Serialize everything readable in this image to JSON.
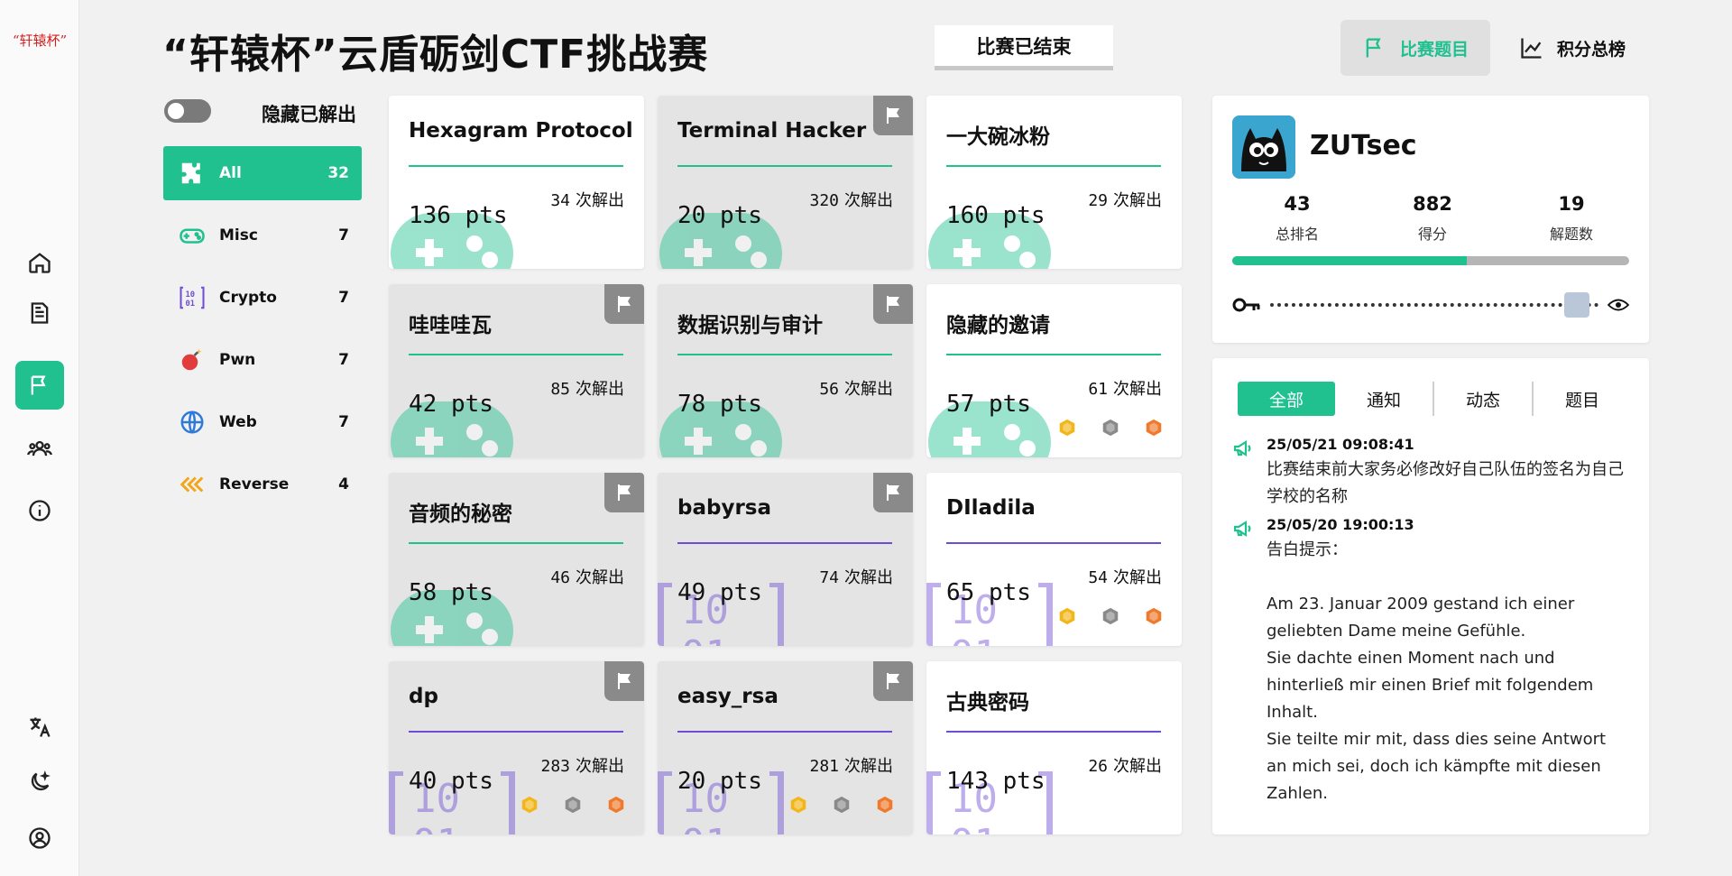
{
  "rail": {
    "logo": "“轩辕杯”",
    "items": [
      "home-icon",
      "document-icon",
      "flag-icon",
      "team-icon",
      "info-icon"
    ],
    "bottom": [
      "translate-icon",
      "theme-icon",
      "user-icon"
    ]
  },
  "header": {
    "title": "“轩辕杯”云盾砺剑CTF挑战赛",
    "status": "比赛已结束",
    "nav": [
      {
        "label": "比赛题目",
        "icon": "flag-icon",
        "active": true
      },
      {
        "label": "积分总榜",
        "icon": "chart-icon",
        "active": false
      }
    ]
  },
  "filter": {
    "hide_solved_label": "隐藏已解出"
  },
  "categories": [
    {
      "name": "All",
      "count": "32",
      "icon": "puzzle-icon"
    },
    {
      "name": "Misc",
      "count": "7",
      "icon": "gamepad-icon"
    },
    {
      "name": "Crypto",
      "count": "7",
      "icon": "binary-icon"
    },
    {
      "name": "Pwn",
      "count": "7",
      "icon": "bomb-icon"
    },
    {
      "name": "Web",
      "count": "7",
      "icon": "globe-icon"
    },
    {
      "name": "Reverse",
      "count": "4",
      "icon": "rewind-icon"
    }
  ],
  "challenges": [
    {
      "name": "Hexagram Protocol",
      "pts": "136 pts",
      "solves": "34",
      "solves_label": "次解出",
      "category": "misc",
      "solved": false,
      "medals": false
    },
    {
      "name": "Terminal Hacker",
      "pts": "20 pts",
      "solves": "320",
      "solves_label": "次解出",
      "category": "misc",
      "solved": true,
      "medals": false
    },
    {
      "name": "一大碗冰粉",
      "pts": "160 pts",
      "solves": "29",
      "solves_label": "次解出",
      "category": "misc",
      "solved": false,
      "medals": false
    },
    {
      "name": "哇哇哇瓦",
      "pts": "42 pts",
      "solves": "85",
      "solves_label": "次解出",
      "category": "misc",
      "solved": true,
      "medals": false
    },
    {
      "name": "数据识别与审计",
      "pts": "78 pts",
      "solves": "56",
      "solves_label": "次解出",
      "category": "misc",
      "solved": true,
      "medals": false
    },
    {
      "name": "隐藏的邀请",
      "pts": "57 pts",
      "solves": "61",
      "solves_label": "次解出",
      "category": "misc",
      "solved": false,
      "medals": true
    },
    {
      "name": "音频的秘密",
      "pts": "58 pts",
      "solves": "46",
      "solves_label": "次解出",
      "category": "misc",
      "solved": true,
      "medals": false
    },
    {
      "name": "babyrsa",
      "pts": "49 pts",
      "solves": "74",
      "solves_label": "次解出",
      "category": "crypto",
      "solved": true,
      "medals": false
    },
    {
      "name": "DIladila",
      "pts": "65 pts",
      "solves": "54",
      "solves_label": "次解出",
      "category": "crypto",
      "solved": false,
      "medals": true
    },
    {
      "name": "dp",
      "pts": "40 pts",
      "solves": "283",
      "solves_label": "次解出",
      "category": "crypto",
      "solved": true,
      "medals": true
    },
    {
      "name": "easy_rsa",
      "pts": "20 pts",
      "solves": "281",
      "solves_label": "次解出",
      "category": "crypto",
      "solved": true,
      "medals": true
    },
    {
      "name": "古典密码",
      "pts": "143 pts",
      "solves": "26",
      "solves_label": "次解出",
      "category": "crypto",
      "solved": false,
      "medals": false
    }
  ],
  "team": {
    "name": "ZUTsec",
    "stats": [
      {
        "value": "43",
        "label": "总排名"
      },
      {
        "value": "882",
        "label": "得分"
      },
      {
        "value": "19",
        "label": "解题数"
      }
    ],
    "progress": 0.59
  },
  "feed": {
    "tabs": [
      "全部",
      "通知",
      "动态",
      "题目"
    ],
    "items": [
      {
        "time": "25/05/21 09:08:41",
        "text": "比赛结束前大家务必修改好自己队伍的签名为自己学校的名称"
      },
      {
        "time": "25/05/20 19:00:13",
        "text": "告白提示：\n\nAm 23. Januar 2009 gestand ich einer geliebten Dame meine Gefühle.\nSie dachte einen Moment nach und hinterließ mir einen Brief mit folgendem Inhalt.\nSie teilte mir mit, dass dies seine Antwort an mich sei, doch ich kämpfte mit diesen Zahlen."
      }
    ]
  },
  "colors": {
    "accent": "#21c08f",
    "crypto": "#6f4cd6",
    "gold": "#f2b619",
    "silver": "#8a8a8a",
    "bronze": "#ef7a2c"
  }
}
